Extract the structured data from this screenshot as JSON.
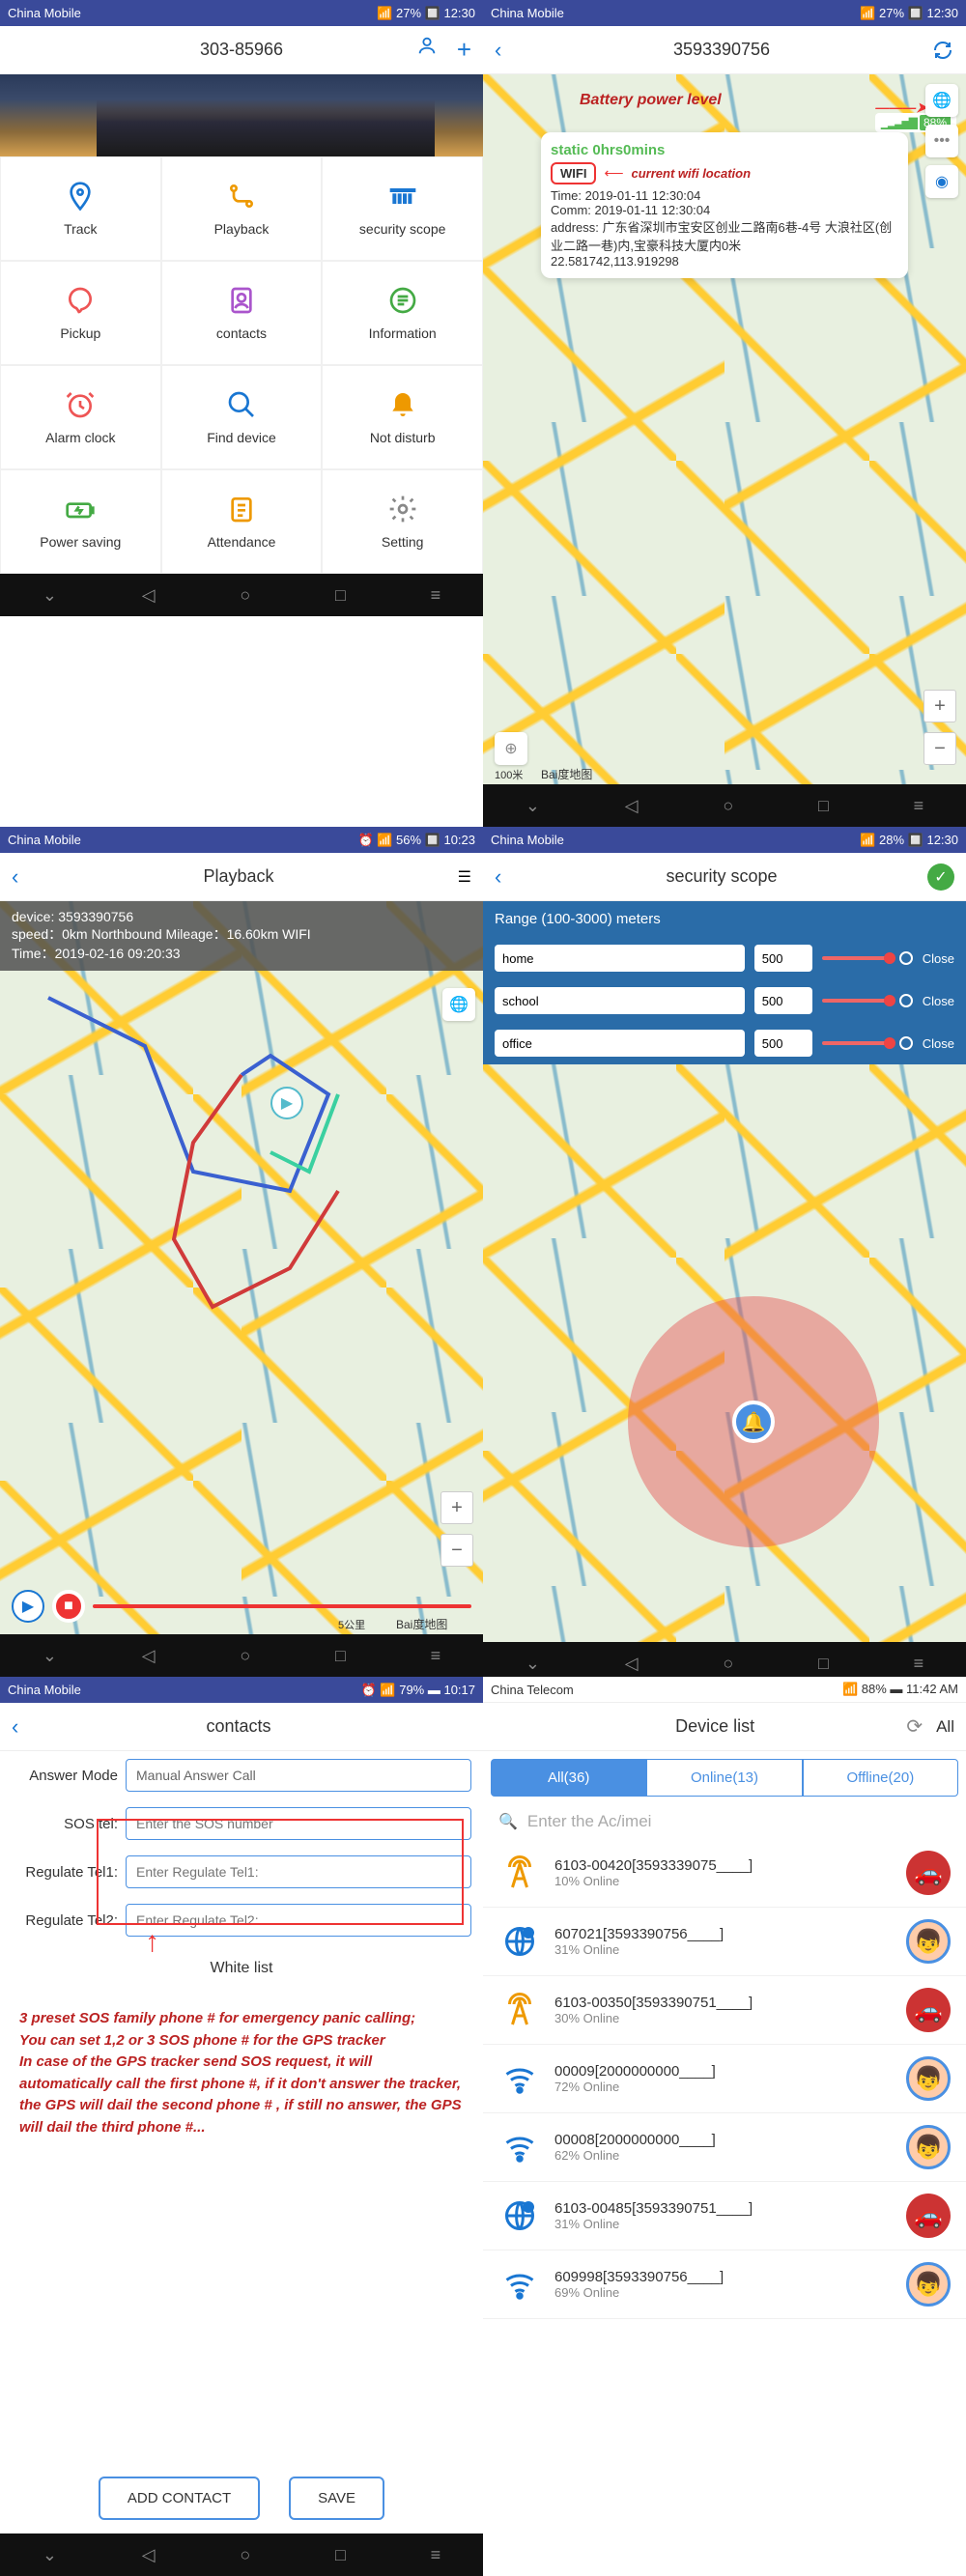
{
  "status_cn": {
    "carrier": "China Mobile",
    "signal_icons": "📶 ⏰",
    "net": "📶 27% 🔲 12:30"
  },
  "status_ct": {
    "carrier": "China Telecom",
    "right": "📶 88% ▬ 11:42 AM"
  },
  "status_p3": {
    "carrier": "China Mobile",
    "right": "⏰ 📶 56% 🔲 10:23"
  },
  "status_p5": {
    "carrier": "China Mobile",
    "right": "⏰ 📶 79% ▬ 10:17"
  },
  "s1": {
    "title": "303-85966",
    "items": [
      "Track",
      "Playback",
      "security scope",
      "Pickup",
      "contacts",
      "Information",
      "Alarm clock",
      "Find device",
      "Not disturb",
      "Power saving",
      "Attendance",
      "Setting"
    ]
  },
  "s2": {
    "title": "3593390756",
    "annot_battery": "Battery power level",
    "pct": "88%",
    "static": "static 0hrs0mins",
    "wifi": "WIFI",
    "annot_wifi": "current wifi location",
    "time": "Time: 2019-01-11 12:30:04",
    "comm": "Comm: 2019-01-11 12:30:04",
    "addr": "address: 广东省深圳市宝安区创业二路南6巷-4号 大浪社区(创业二路一巷)内,宝豪科技大厦内0米",
    "coords": "22.581742,113.919298",
    "scale": "100米",
    "baidu": "Bai度地图"
  },
  "s3": {
    "title": "Playback",
    "device": "device: 3593390756",
    "speed": "speed：0km Northbound Mileage：16.60km WIFI",
    "time": "Time：2019-02-16 09:20:33",
    "scale": "5公里",
    "baidu": "Bai度地图"
  },
  "s4": {
    "title": "security scope",
    "range_label": "Range (100-3000)  meters",
    "rows": [
      {
        "name": "home",
        "val": "500",
        "close": "Close"
      },
      {
        "name": "school",
        "val": "500",
        "close": "Close"
      },
      {
        "name": "office",
        "val": "500",
        "close": "Close"
      }
    ]
  },
  "s5": {
    "title": "contacts",
    "answer_label": "Answer Mode",
    "answer_val": "Manual Answer Call",
    "sos_label": "SOS tel:",
    "sos_ph": "Enter the SOS number",
    "reg1_label": "Regulate Tel1:",
    "reg1_ph": "Enter Regulate Tel1:",
    "reg2_label": "Regulate Tel2:",
    "reg2_ph": "Enter Regulate Tel2:",
    "whitelist": "White list",
    "note": "3 preset SOS family phone # for emergency panic calling;\nYou can set 1,2 or 3 SOS phone # for the GPS tracker\nIn case of the GPS tracker send SOS request, it will automatically call the first phone #, if it don't answer the tracker, the GPS will dail the second phone # , if still no answer, the GPS will dail the third phone #...",
    "add": "ADD CONTACT",
    "save": "SAVE"
  },
  "s6": {
    "title": "Device list",
    "all": "All",
    "tabs": [
      "All(36)",
      "Online(13)",
      "Offline(20)"
    ],
    "search_ph": "Enter the Ac/imei",
    "devices": [
      {
        "name": "6103-00420[3593339075____]",
        "status": "10%  Online",
        "ico": "tower",
        "av": "car"
      },
      {
        "name": "607021[3593390756____]",
        "status": "31%  Online",
        "ico": "globe",
        "av": "boy"
      },
      {
        "name": "6103-00350[3593390751____]",
        "status": "30%  Online",
        "ico": "tower",
        "av": "car"
      },
      {
        "name": "00009[2000000000____]",
        "status": "72%  Online",
        "ico": "wifi",
        "av": "boy"
      },
      {
        "name": "00008[2000000000____]",
        "status": "62%  Online",
        "ico": "wifi",
        "av": "boy"
      },
      {
        "name": "6103-00485[3593390751____]",
        "status": "31%  Online",
        "ico": "globe",
        "av": "car"
      },
      {
        "name": "609998[3593390756____]",
        "status": "69%  Online",
        "ico": "wifi",
        "av": "boy"
      }
    ]
  }
}
